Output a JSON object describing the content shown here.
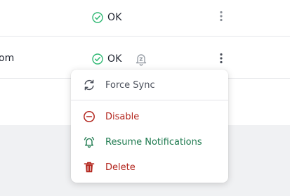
{
  "table": {
    "rows": [
      {
        "name": "",
        "status": "OK",
        "status_icon": "check-circle-icon",
        "actions_icon": "more-vertical-icon"
      },
      {
        "name": "om",
        "status": "OK",
        "status_icon": "check-circle-icon",
        "snooze_icon": "notifications-snoozed-icon",
        "actions_icon": "more-vertical-icon"
      }
    ]
  },
  "menu": {
    "items": [
      {
        "label": "Force Sync",
        "icon": "sync-icon",
        "color": "#4a4f5a"
      },
      {
        "label": "Disable",
        "icon": "minus-circle-icon",
        "color": "#b3261e"
      },
      {
        "label": "Resume Notifications",
        "icon": "bell-ringing-icon",
        "color": "#1e7a4f"
      },
      {
        "label": "Delete",
        "icon": "trash-icon",
        "color": "#b3261e"
      }
    ]
  },
  "colors": {
    "ok_green": "#2eb872",
    "danger_red": "#b3261e",
    "success_green": "#1e7a4f",
    "muted_icon": "#8a8f98"
  }
}
